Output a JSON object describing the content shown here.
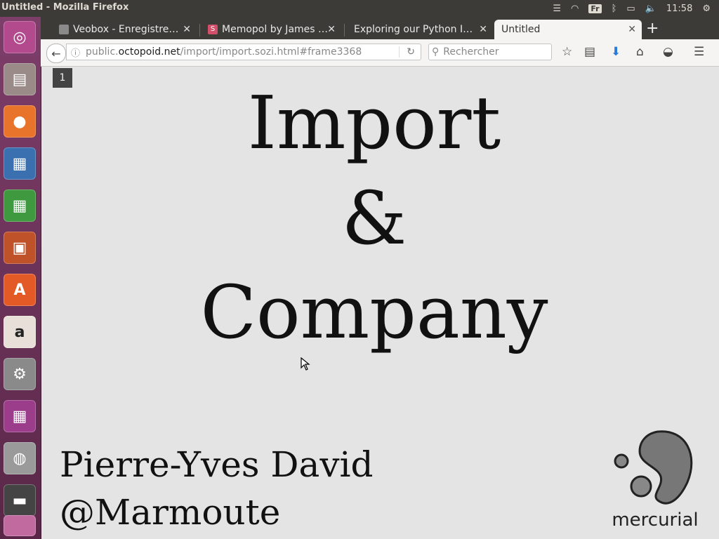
{
  "window_title": "Untitled - Mozilla Firefox",
  "panel": {
    "lang": "Fr",
    "time": "11:58"
  },
  "tabs": [
    {
      "label": "Veobox - Enregistre…",
      "favicon_color": "#8a8a8a"
    },
    {
      "label": "Memopol by James …",
      "favicon_color": "#d4506a",
      "favicon_text": "S"
    },
    {
      "label": "Exploring our Python I…"
    },
    {
      "label": "Untitled"
    }
  ],
  "url": {
    "prefix": "public.",
    "domain": "octopoid.net",
    "path": "/import/import.sozi.html#frame3368"
  },
  "search_placeholder": "Rechercher",
  "slide": {
    "frame_number": "1",
    "title_lines": [
      "Import",
      "&",
      "Company"
    ],
    "author_name": "Pierre-Yves David",
    "author_handle": "@Marmoute",
    "logo_text": "mercurial"
  },
  "colors": {
    "panel": "#3c3b37",
    "launcher": "#7d3e6a",
    "page_bg": "#e4e4e4"
  }
}
